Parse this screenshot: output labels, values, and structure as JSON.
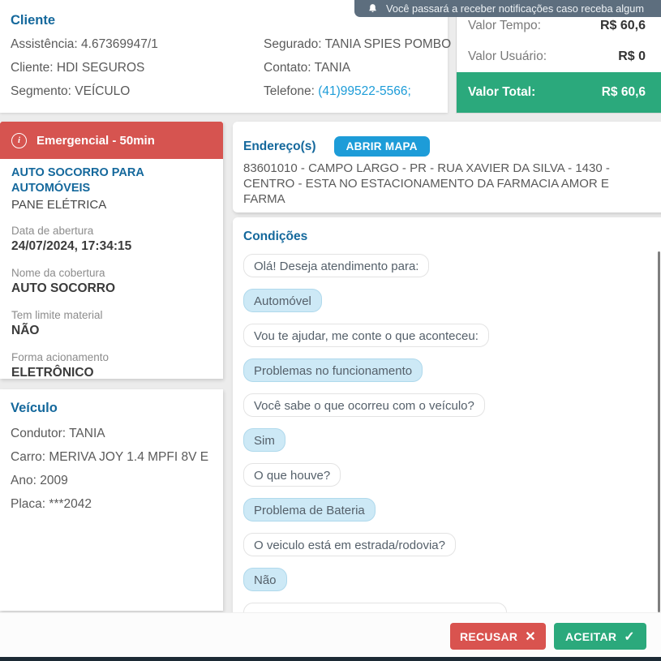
{
  "toast": {
    "text": "Você passará a receber notificações caso receba algum"
  },
  "client": {
    "title": "Cliente",
    "left": [
      {
        "label": "Assistência:",
        "value": "4.67369947/1",
        "type": "plain"
      },
      {
        "label": "Cliente:",
        "value": "HDI SEGUROS",
        "type": "plain"
      },
      {
        "label": "Segmento:",
        "value": "VEÍCULO",
        "type": "plain"
      }
    ],
    "right": [
      {
        "label": "Segurado:",
        "value": "TANIA SPIES POMBO",
        "type": "plain"
      },
      {
        "label": "Contato:",
        "value": "TANIA",
        "type": "plain"
      },
      {
        "label": "Telefone:",
        "value": "(41)99522-5566;",
        "type": "link"
      }
    ]
  },
  "billing": {
    "rows": [
      {
        "label": "Valor Tempo:",
        "value": "R$ 60,6"
      },
      {
        "label": "Valor Usuário:",
        "value": "R$ 0"
      }
    ],
    "total_label": "Valor Total:",
    "total_value": "R$ 60,6"
  },
  "service": {
    "urgency_label": "Emergencial - 50min",
    "info_glyph": "i",
    "title": "AUTO SOCORRO PARA AUTOMÓVEIS",
    "subtitle": "PANE ELÉTRICA",
    "details": [
      {
        "label": "Data de abertura",
        "value": "24/07/2024, 17:34:15"
      },
      {
        "label": "Nome da cobertura",
        "value": "AUTO SOCORRO"
      },
      {
        "label": "Tem limite material",
        "value": "NÃO"
      },
      {
        "label": "Forma acionamento",
        "value": "ELETRÔNICO"
      }
    ]
  },
  "vehicle": {
    "title": "Veículo",
    "fields": [
      {
        "label": "Condutor:",
        "value": "TANIA",
        "type": "plain"
      },
      {
        "label": "Carro:",
        "value": "MERIVA JOY 1.4 MPFI 8V E",
        "type": "plain"
      },
      {
        "label": "Ano:",
        "value": "2009",
        "type": "plain"
      },
      {
        "label": "Placa:",
        "value": "***2042",
        "type": "plain"
      }
    ]
  },
  "address": {
    "title": "Endereço(s)",
    "map_button_label": "ABRIR MAPA",
    "full_address": "83601010 - CAMPO LARGO - PR - RUA XAVIER DA SILVA - 1430 - CENTRO - ESTA NO ESTACIONAMENTO DA FARMACIA AMOR E FARMA"
  },
  "conditions": {
    "title": "Condições",
    "messages": [
      {
        "text": "Olá! Deseja atendimento para:",
        "type": "question"
      },
      {
        "text": "Automóvel",
        "type": "answer"
      },
      {
        "text": "Vou te ajudar, me conte o que aconteceu:",
        "type": "question"
      },
      {
        "text": "Problemas no funcionamento",
        "type": "answer"
      },
      {
        "text": "Você sabe o que ocorreu com o veículo?",
        "type": "question"
      },
      {
        "text": "Sim",
        "type": "answer"
      },
      {
        "text": "O que houve?",
        "type": "question"
      },
      {
        "text": "Problema de Bateria",
        "type": "answer"
      },
      {
        "text": "O veiculo está em estrada/rodovia?",
        "type": "question"
      },
      {
        "text": "Não",
        "type": "answer"
      }
    ]
  },
  "actions": {
    "reject_label": "RECUSAR",
    "reject_glyph": "✕",
    "accept_label": "ACEITAR",
    "accept_glyph": "✓"
  },
  "colors": {
    "accent_blue": "#14689C",
    "action_blue": "#1D9CD8",
    "danger_red": "#D9534F",
    "success_green": "#2BA97C",
    "toast_slate": "#5D6E7E",
    "bubble_blue": "#CDE9F6"
  }
}
